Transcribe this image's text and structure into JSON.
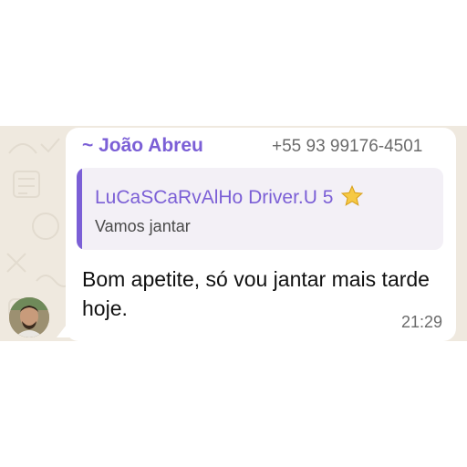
{
  "message": {
    "sender_name": "~ João Abreu",
    "sender_phone": "+55 93 99176-4501",
    "reply": {
      "author": "LuCaSCaRvAlHo Driver.U 5",
      "author_badge": "star-emoji",
      "text": "Vamos jantar"
    },
    "body": "Bom apetite, só vou jantar mais tarde hoje.",
    "time": "21:29"
  },
  "colors": {
    "sender_accent": "#7b5fd6",
    "chat_background": "#efe9df",
    "bubble": "#ffffff",
    "quote_background": "#f3f0f6"
  }
}
